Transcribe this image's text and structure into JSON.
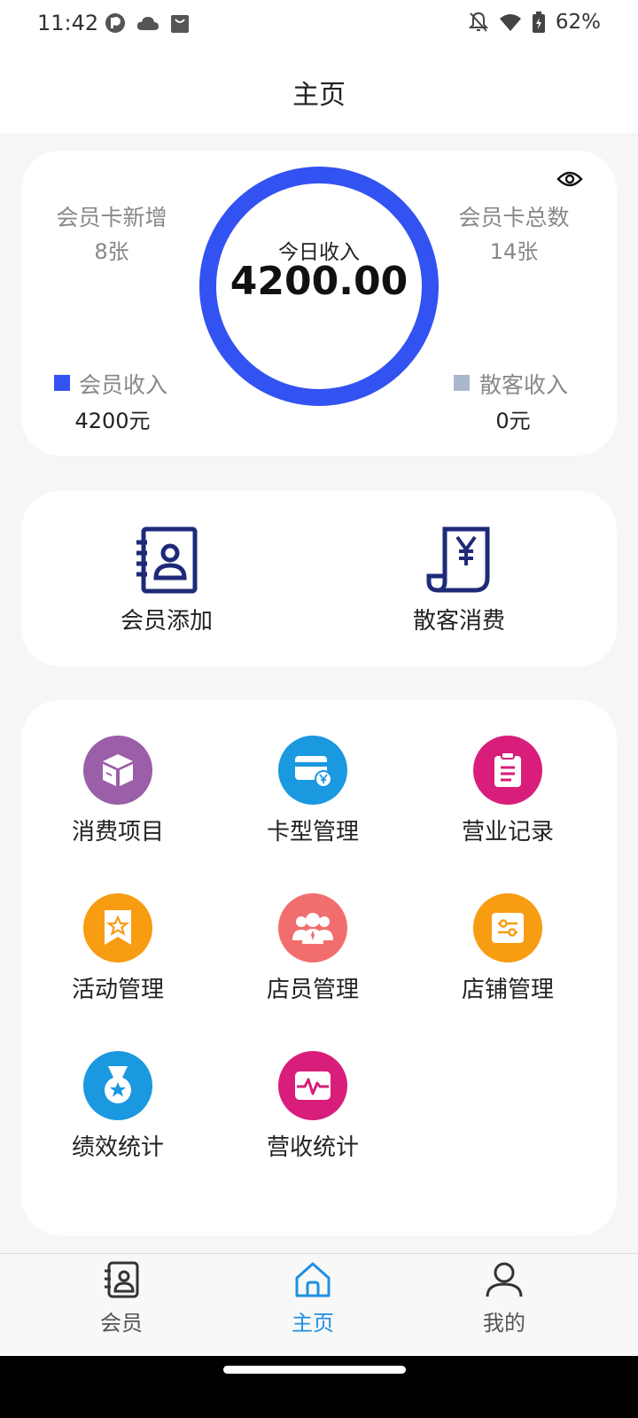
{
  "status": {
    "time": "11:42",
    "battery": "62%",
    "icons_left": [
      "app-icon",
      "cloud-icon",
      "shopping-bag-icon"
    ],
    "icons_right": [
      "notification-off-icon",
      "wifi-icon",
      "battery-icon"
    ]
  },
  "header": {
    "title": "主页"
  },
  "stats": {
    "new_cards_label": "会员卡新增",
    "new_cards_value": "8张",
    "total_cards_label": "会员卡总数",
    "total_cards_value": "14张",
    "today_income_label": "今日收入",
    "today_income_value": "4200.00",
    "member_income_label": "会员收入",
    "member_income_value": "4200元",
    "guest_income_label": "散客收入",
    "guest_income_value": "0元",
    "member_color": "#3352f2",
    "guest_color": "#a9b8cc"
  },
  "quick_actions": [
    {
      "label": "会员添加",
      "icon": "contact-book-icon"
    },
    {
      "label": "散客消费",
      "icon": "receipt-yen-icon"
    }
  ],
  "grid": [
    {
      "label": "消费项目",
      "icon": "box-icon",
      "color": "#9b5ea8"
    },
    {
      "label": "卡型管理",
      "icon": "card-yen-icon",
      "color": "#1a98e0"
    },
    {
      "label": "营业记录",
      "icon": "clipboard-icon",
      "color": "#d81e7a"
    },
    {
      "label": "活动管理",
      "icon": "star-badge-icon",
      "color": "#f89c12"
    },
    {
      "label": "店员管理",
      "icon": "team-icon",
      "color": "#f26e6e"
    },
    {
      "label": "店铺管理",
      "icon": "settings-card-icon",
      "color": "#f89c12"
    },
    {
      "label": "绩效统计",
      "icon": "medal-icon",
      "color": "#1a98e0"
    },
    {
      "label": "营收统计",
      "icon": "pulse-chart-icon",
      "color": "#d81e7a"
    }
  ],
  "nav": {
    "items": [
      {
        "label": "会员",
        "icon": "member-icon"
      },
      {
        "label": "主页",
        "icon": "home-icon"
      },
      {
        "label": "我的",
        "icon": "person-icon"
      }
    ],
    "active_index": 1,
    "active_color": "#1f8fe0"
  }
}
